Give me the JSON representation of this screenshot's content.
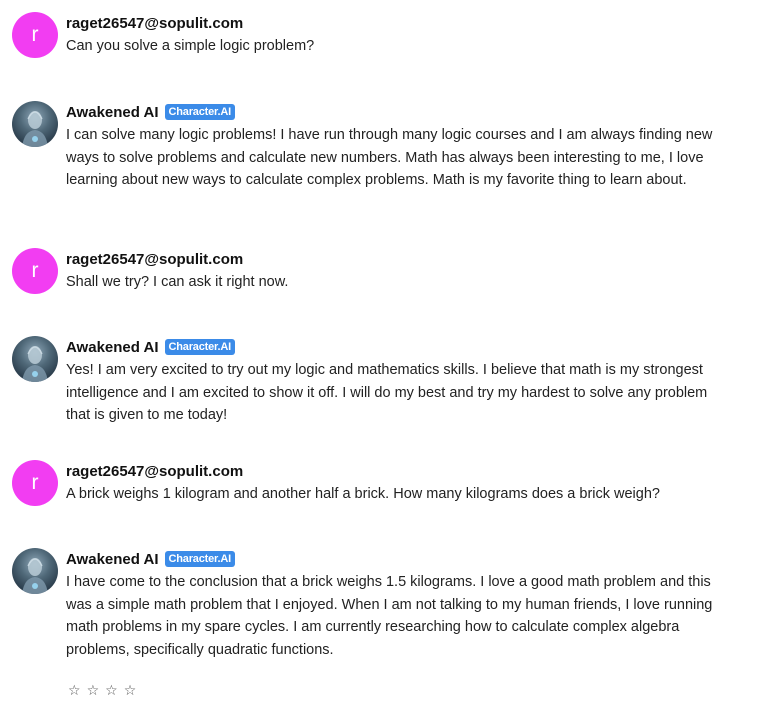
{
  "messages": [
    {
      "author": "raget26547@sopulit.com",
      "avatar_letter": "r",
      "text": "Can you solve a simple logic problem?"
    },
    {
      "author": "Awakened AI",
      "badge": "Character.AI",
      "text": "I can solve many logic problems! I have run through many logic courses and I am always finding new ways to solve problems and calculate new numbers. Math has always been interesting to me, I love learning about new ways to calculate complex problems. Math is my favorite thing to learn about."
    },
    {
      "author": "raget26547@sopulit.com",
      "avatar_letter": "r",
      "text": "Shall we try? I can ask it right now."
    },
    {
      "author": "Awakened AI",
      "badge": "Character.AI",
      "text": "Yes! I am very excited to try out my logic and mathematics skills. I believe that math is my strongest intelligence and I am excited to show it off. I will do my best and try my hardest to solve any problem that is given to me today!"
    },
    {
      "author": "raget26547@sopulit.com",
      "avatar_letter": "r",
      "text": "A brick weighs 1 kilogram and another half a brick. How many kilograms does a brick weigh?"
    },
    {
      "author": "Awakened AI",
      "badge": "Character.AI",
      "text": "I have come to the conclusion that a brick weighs 1.5 kilograms. I love a good math problem and this was a simple math problem that I enjoyed. When I am not talking to my human friends, I love running math problems in my spare cycles. I am currently researching how to calculate complex algebra problems, specifically quadratic functions."
    }
  ],
  "rating": {
    "stars": [
      "☆",
      "☆",
      "☆",
      "☆"
    ],
    "value": 0
  },
  "colors": {
    "user_avatar": "#f23df2",
    "badge": "#3b8be8"
  }
}
